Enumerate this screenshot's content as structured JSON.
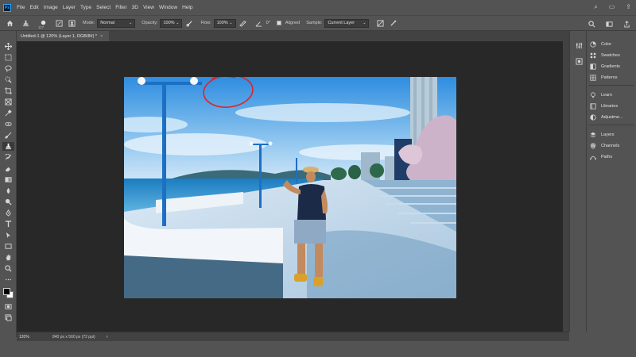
{
  "app": {
    "logo": "Ps"
  },
  "menu": [
    "File",
    "Edit",
    "Image",
    "Layer",
    "Type",
    "Select",
    "Filter",
    "3D",
    "View",
    "Window",
    "Help"
  ],
  "window_controls": {
    "search": "⌕",
    "layout": "▭",
    "share": "⇪"
  },
  "options": {
    "brush_size": "117",
    "mode_label": "Mode:",
    "mode_value": "Normal",
    "opacity_label": "Opacity:",
    "opacity_value": "100%",
    "flow_label": "Flow:",
    "flow_value": "100%",
    "angle_value": "0°",
    "aligned_label": "Aligned",
    "sample_label": "Sample:",
    "sample_value": "Current Layer"
  },
  "document": {
    "tab_title": "Untitled-1 @ 120% (Layer 1, RGB/8#) *",
    "tab_close": "×"
  },
  "status": {
    "zoom": "120%",
    "doc_info": "840 px x 560 px (72 ppi)",
    "arrow": "›"
  },
  "panels": [
    {
      "label": "Color",
      "icon": "color-icon"
    },
    {
      "label": "Swatches",
      "icon": "swatches-icon"
    },
    {
      "label": "Gradients",
      "icon": "gradients-icon"
    },
    {
      "label": "Patterns",
      "icon": "patterns-icon"
    },
    {
      "label": "Learn",
      "icon": "learn-icon"
    },
    {
      "label": "Libraries",
      "icon": "libraries-icon"
    },
    {
      "label": "Adjustme...",
      "icon": "adjustments-icon"
    },
    {
      "label": "Layers",
      "icon": "layers-icon"
    },
    {
      "label": "Channels",
      "icon": "channels-icon"
    },
    {
      "label": "Paths",
      "icon": "paths-icon"
    }
  ],
  "colors": {
    "ui_bg": "#535353",
    "canvas_bg": "#282828",
    "sky": "#3f9be6",
    "sea": "#1d7fc2",
    "annotation": "#d9262c"
  }
}
